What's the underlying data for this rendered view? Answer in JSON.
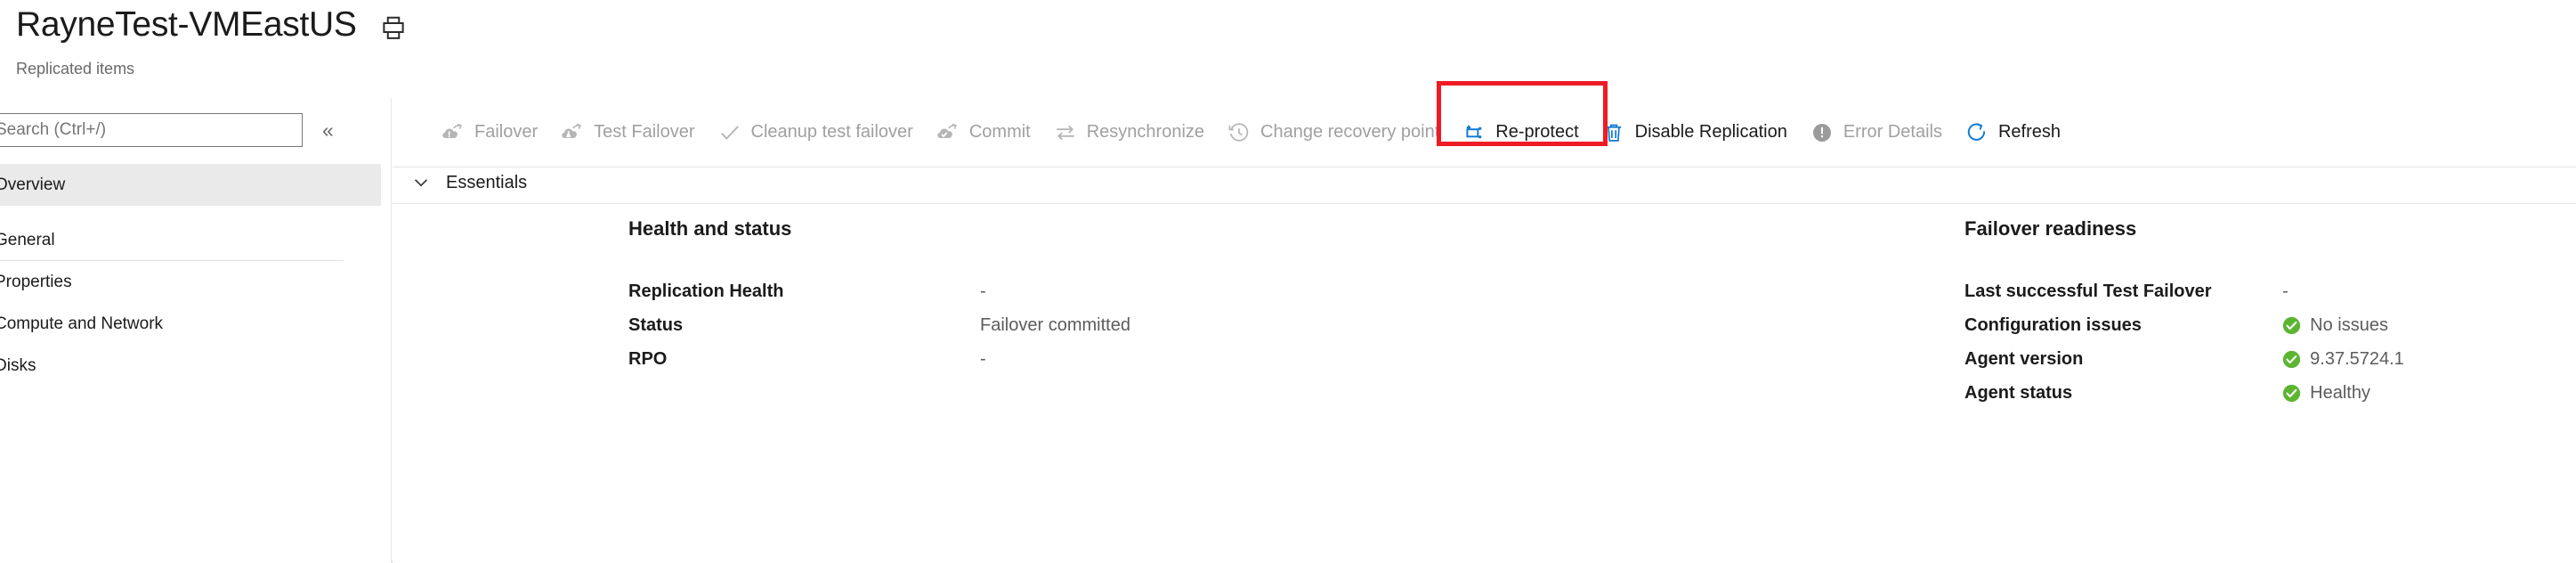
{
  "header": {
    "title": "RayneTest-VMEastUS",
    "subtitle": "Replicated items",
    "print_icon": "print-icon"
  },
  "sidebar": {
    "search": {
      "placeholder": "Search (Ctrl+/)",
      "value": ""
    },
    "collapse_label": "«",
    "items": [
      {
        "label": "Overview",
        "type": "item",
        "selected": true
      },
      {
        "label": "General",
        "type": "section",
        "selected": false
      },
      {
        "label": "Properties",
        "type": "item",
        "selected": false
      },
      {
        "label": "Compute and Network",
        "type": "item",
        "selected": false
      },
      {
        "label": "Disks",
        "type": "item",
        "selected": false
      }
    ]
  },
  "commandbar": {
    "items": [
      {
        "label": "Failover",
        "icon": "failover-icon",
        "enabled": false
      },
      {
        "label": "Test Failover",
        "icon": "test-failover-icon",
        "enabled": false
      },
      {
        "label": "Cleanup test failover",
        "icon": "checkmark-icon",
        "enabled": false
      },
      {
        "label": "Commit",
        "icon": "commit-icon",
        "enabled": false
      },
      {
        "label": "Resynchronize",
        "icon": "resynchronize-icon",
        "enabled": false
      },
      {
        "label": "Change recovery point",
        "icon": "clock-history-icon",
        "enabled": false
      },
      {
        "label": "Re-protect",
        "icon": "re-protect-icon",
        "enabled": true,
        "highlighted": true
      },
      {
        "label": "Disable Replication",
        "icon": "trash-icon",
        "enabled": true
      },
      {
        "label": "Error Details",
        "icon": "error-circle-icon",
        "enabled": false
      },
      {
        "label": "Refresh",
        "icon": "refresh-icon",
        "enabled": true
      }
    ],
    "highlight_color": "#ee1b24"
  },
  "content": {
    "essentials_label": "Essentials",
    "essentials_chevron": "chevron-down-icon",
    "panels": [
      {
        "title": "Health and status",
        "rows": [
          {
            "key": "Replication Health",
            "value": "-",
            "status": null
          },
          {
            "key": "Status",
            "value": "Failover committed",
            "status": null
          },
          {
            "key": "RPO",
            "value": "-",
            "status": null
          }
        ]
      },
      {
        "title": "Failover readiness",
        "rows": [
          {
            "key": "Last successful Test Failover",
            "value": "-",
            "status": null
          },
          {
            "key": "Configuration issues",
            "value": "No issues",
            "status": "success"
          },
          {
            "key": "Agent version",
            "value": "9.37.5724.1",
            "status": "success"
          },
          {
            "key": "Agent status",
            "value": "Healthy",
            "status": "success"
          }
        ]
      }
    ]
  },
  "colors": {
    "accent_blue": "#0078d4",
    "success_green": "#5cb531",
    "disabled_grey": "#a0a0a0",
    "text_dark": "#1b1b1b",
    "text_muted": "#5c5c5c",
    "highlight_red": "#ee1b24"
  }
}
